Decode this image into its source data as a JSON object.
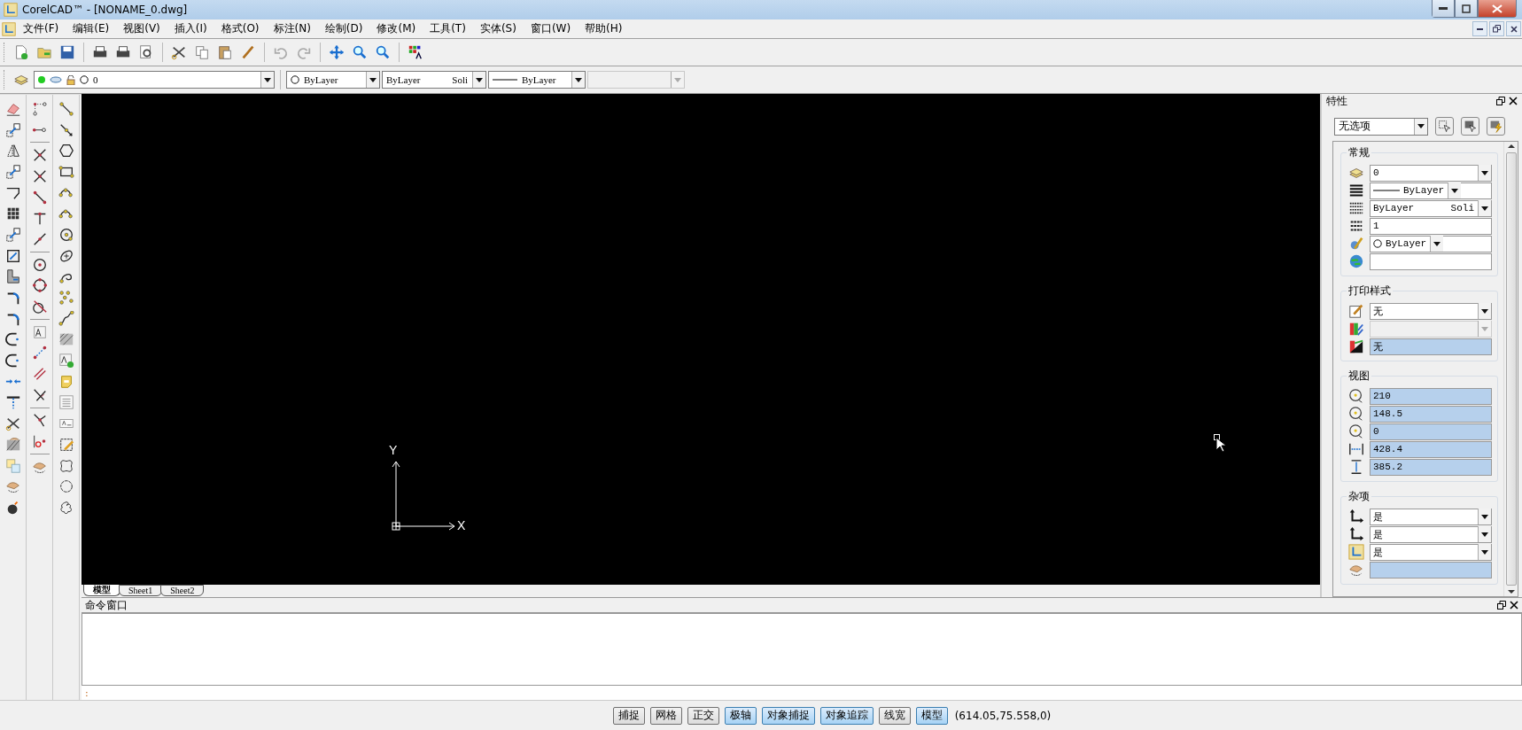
{
  "window": {
    "title": "CorelCAD™ - [NONAME_0.dwg]"
  },
  "menu": [
    "文件(F)",
    "编辑(E)",
    "视图(V)",
    "插入(I)",
    "格式(O)",
    "标注(N)",
    "绘制(D)",
    "修改(M)",
    "工具(T)",
    "实体(S)",
    "窗口(W)",
    "帮助(H)"
  ],
  "layer_bar": {
    "layer": "0",
    "color_setting": "ByLayer",
    "linetype": {
      "name": "ByLayer",
      "description": "Soli"
    },
    "lineweight": "ByLayer"
  },
  "canvas": {
    "x_label": "X",
    "y_label": "Y"
  },
  "sheet_tabs": [
    {
      "label": "模型",
      "selected": true
    },
    {
      "label": "Sheet1",
      "selected": false
    },
    {
      "label": "Sheet2",
      "selected": false
    }
  ],
  "properties": {
    "title": "特性",
    "selection": "无选项",
    "groups": [
      {
        "title": "常规",
        "fields": [
          {
            "kind": "combo",
            "value": "0"
          },
          {
            "kind": "line-combo",
            "value": "ByLayer"
          },
          {
            "kind": "linetype-combo",
            "value": "ByLayer",
            "description": "Soli"
          },
          {
            "kind": "text",
            "value": "1"
          },
          {
            "kind": "color-combo",
            "value": "ByLayer"
          },
          {
            "kind": "text"
          }
        ]
      },
      {
        "title": "打印样式",
        "fields": [
          {
            "kind": "combo",
            "value": "无"
          },
          {
            "kind": "combo",
            "disabled": true
          },
          {
            "kind": "readonly",
            "value": "无"
          }
        ]
      },
      {
        "title": "视图",
        "fields": [
          {
            "kind": "readonly",
            "value": "210"
          },
          {
            "kind": "readonly",
            "value": "148.5"
          },
          {
            "kind": "readonly",
            "value": "0"
          },
          {
            "kind": "readonly",
            "value": "428.4"
          },
          {
            "kind": "readonly",
            "value": "385.2"
          }
        ]
      },
      {
        "title": "杂项",
        "fields": [
          {
            "kind": "combo",
            "value": "是"
          },
          {
            "kind": "combo",
            "value": "是"
          },
          {
            "kind": "combo",
            "value": "是"
          },
          {
            "kind": "readonly"
          }
        ]
      }
    ]
  },
  "command_window": {
    "title": "命令窗口",
    "prompt": ":"
  },
  "status_bar": {
    "toggles": [
      {
        "label": "捕捉",
        "on": false
      },
      {
        "label": "网格",
        "on": false
      },
      {
        "label": "正交",
        "on": false
      },
      {
        "label": "极轴",
        "on": true
      },
      {
        "label": "对象捕捉",
        "on": true
      },
      {
        "label": "对象追踪",
        "on": true
      },
      {
        "label": "线宽",
        "on": false
      },
      {
        "label": "模型",
        "on": true
      }
    ],
    "coordinates": "(614.05,75.558,0)"
  }
}
